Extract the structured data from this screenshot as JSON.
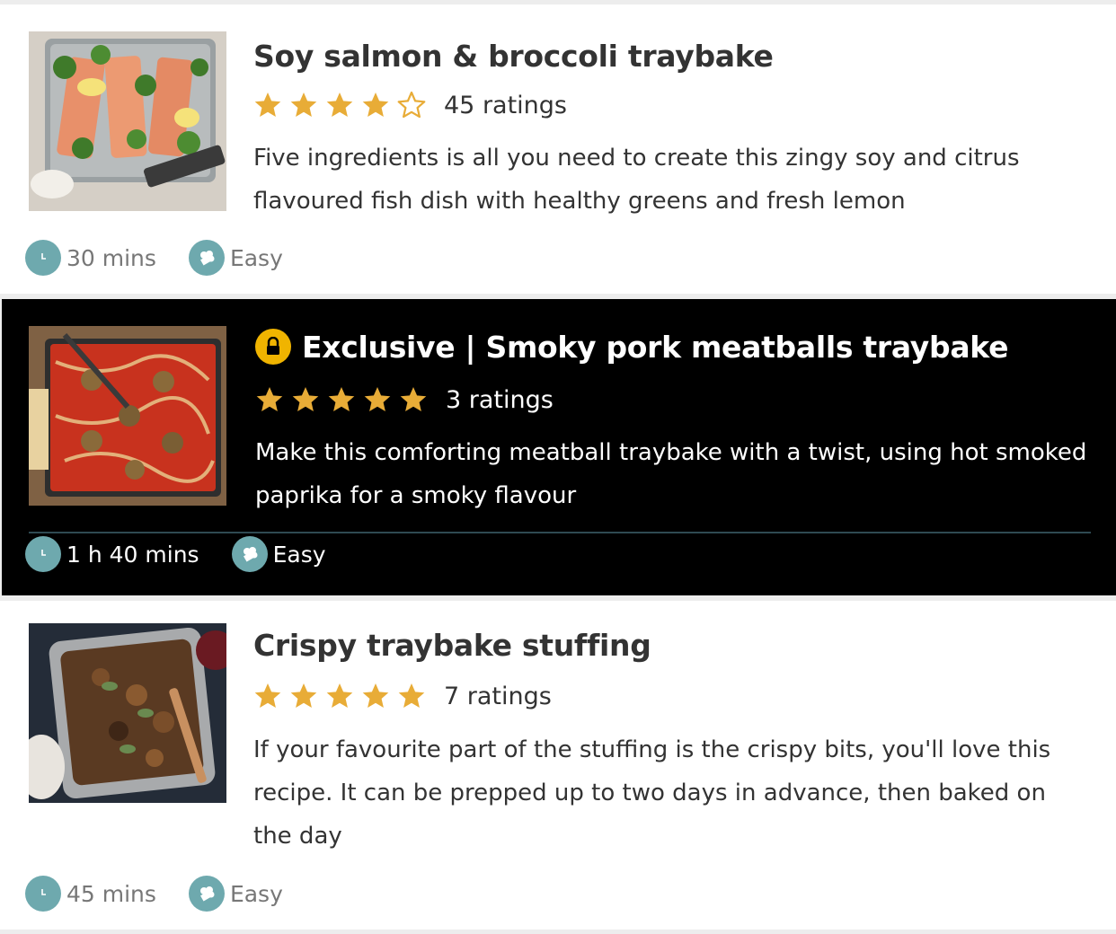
{
  "colors": {
    "star": "#e8ac37",
    "accent_teal": "#6ea9ae",
    "lock_badge": "#f0b400",
    "exclusive_background": "#000000"
  },
  "recipes": [
    {
      "title": "Soy salmon & broccoli traybake",
      "rating": 4,
      "max_rating": 5,
      "ratings_label": "45 ratings",
      "description": "Five ingredients is all you need to create this zingy soy and citrus flavoured fish dish with healthy greens and fresh lemon",
      "time": "30 mins",
      "difficulty": "Easy",
      "image_icon": "salmon-traybake-image",
      "exclusive": false
    },
    {
      "title": "Exclusive | Smoky pork meatballs traybake",
      "rating": 5,
      "max_rating": 5,
      "ratings_label": "3 ratings",
      "description": "Make this comforting meatball traybake with a twist, using hot smoked paprika for a smoky flavour",
      "time": "1 h 40 mins",
      "difficulty": "Easy",
      "image_icon": "meatballs-traybake-image",
      "exclusive": true,
      "badge_icon": "lock-icon"
    },
    {
      "title": "Crispy traybake stuffing",
      "rating": 5,
      "max_rating": 5,
      "ratings_label": "7 ratings",
      "description": "If your favourite part of the stuffing is the crispy bits, you'll love this recipe. It can be prepped up to two days in advance, then baked on the day",
      "time": "45 mins",
      "difficulty": "Easy",
      "image_icon": "stuffing-traybake-image",
      "exclusive": false
    }
  ],
  "icons": {
    "time": "clock-icon",
    "difficulty": "chef-hat-icon"
  }
}
